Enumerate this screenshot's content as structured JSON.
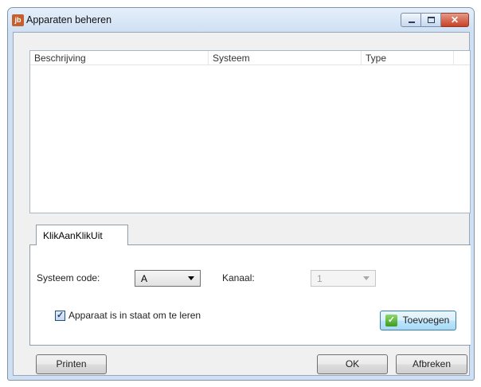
{
  "window": {
    "title": "Apparaten beheren",
    "icon_text": "jb",
    "controls": [
      "minimize-icon",
      "maximize-icon",
      "close-icon"
    ]
  },
  "listview": {
    "columns": [
      "Beschrijving",
      "Systeem",
      "Type"
    ],
    "rows": []
  },
  "tabs": [
    {
      "label": "KlikAanKlikUit",
      "selected": true
    }
  ],
  "form": {
    "systeem_code_label": "Systeem code:",
    "systeem_code_value": "A",
    "kanaal_label": "Kanaal:",
    "kanaal_value": "1",
    "kanaal_enabled": false,
    "checkbox_label": "Apparaat is in staat om te leren",
    "checkbox_checked": true,
    "add_button_label": "Toevoegen",
    "add_button_icon": "add-check-icon"
  },
  "footer": {
    "print_label": "Printen",
    "ok_label": "OK",
    "cancel_label": "Afbreken"
  },
  "colors": {
    "title_bar": "#cfe0f3",
    "close_button": "#c74127",
    "add_icon": "#3d9b22"
  }
}
